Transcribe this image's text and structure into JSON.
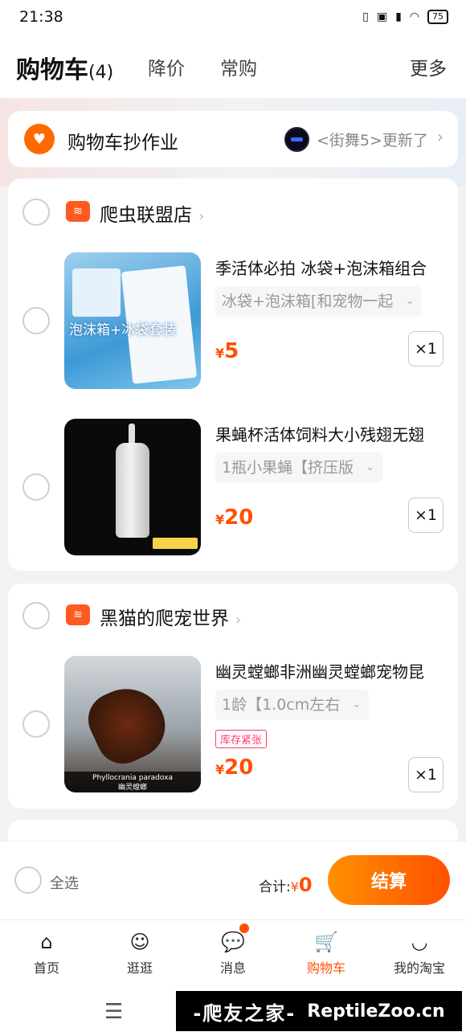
{
  "status": {
    "time": "21:38",
    "battery": "75"
  },
  "header": {
    "title": "购物车",
    "count": "(4)",
    "tabs": [
      "降价",
      "常购"
    ],
    "more": "更多"
  },
  "promo": {
    "label": "购物车抄作业",
    "news": "<街舞5>更新了"
  },
  "stores": [
    {
      "name": "爬虫联盟店",
      "items": [
        {
          "name": "季活体必拍 冰袋+泡沫箱组合",
          "sku": "冰袋+泡沫箱[和宠物一起",
          "currency": "¥",
          "price": "5",
          "qty": "×1",
          "image_text": "泡沫箱+冰袋套装"
        },
        {
          "name": "果蝇杯活体饲料大小残翅无翅",
          "sku": "1瓶小果蝇【挤压版",
          "currency": "¥",
          "price": "20",
          "qty": "×1"
        }
      ]
    },
    {
      "name": "黑猫的爬宠世界",
      "items": [
        {
          "name": "幽灵螳螂非洲幽灵螳螂宠物昆",
          "sku": "1龄【1.0cm左右",
          "badge": "库存紧张",
          "currency": "¥",
          "price": "20",
          "qty": "×1",
          "caption": "Phyllocrania paradoxa",
          "caption_cn": "幽灵螳螂"
        }
      ]
    }
  ],
  "checkout": {
    "select_all": "全选",
    "total_label": "合计:",
    "currency": "¥",
    "total": "0",
    "pay": "结算"
  },
  "tabbar": [
    {
      "label": "首页",
      "icon": "home-icon"
    },
    {
      "label": "逛逛",
      "icon": "browse-icon"
    },
    {
      "label": "消息",
      "icon": "message-icon"
    },
    {
      "label": "购物车",
      "icon": "cart-icon"
    },
    {
      "label": "我的淘宝",
      "icon": "profile-icon"
    }
  ],
  "watermark": {
    "cn": "-爬友之家-",
    "en": "ReptileZoo.cn"
  },
  "colors": {
    "accent": "#ff5000",
    "accent_start": "#ff9000"
  }
}
